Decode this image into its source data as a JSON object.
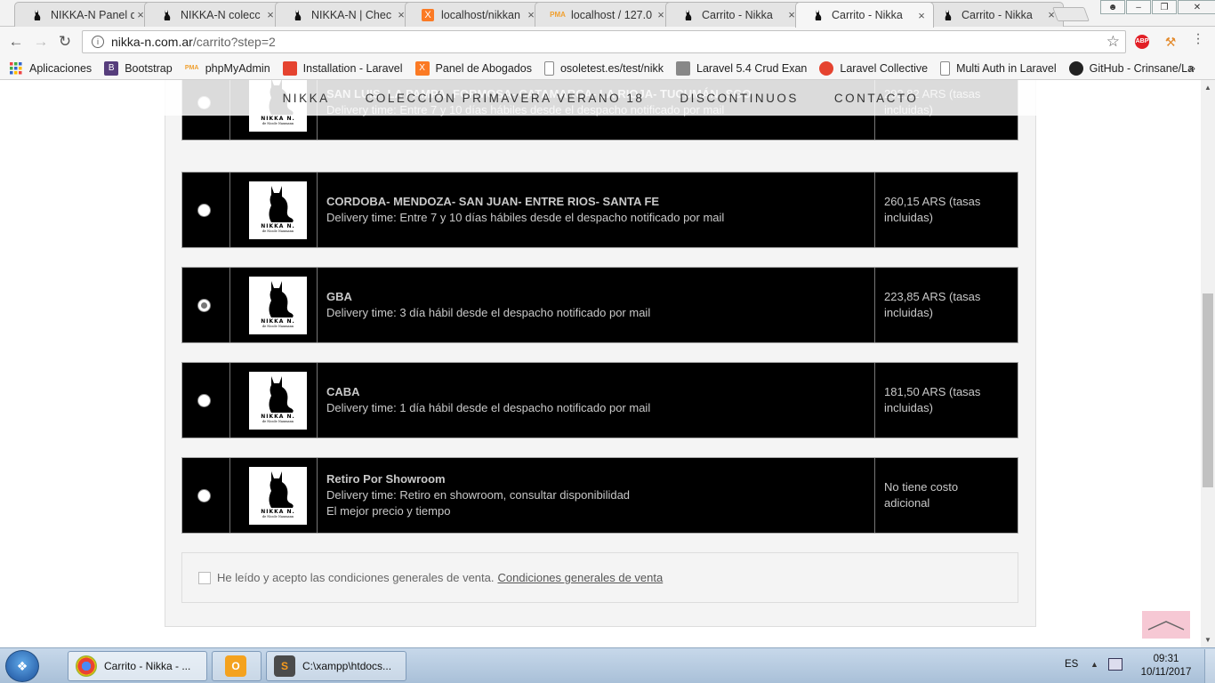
{
  "browser": {
    "tabs": [
      {
        "title": "NIKKA-N Panel d",
        "favicon": "cat-icon",
        "active": false
      },
      {
        "title": "NIKKA-N colecc",
        "favicon": "cat-icon",
        "active": false
      },
      {
        "title": "NIKKA-N | Chec",
        "favicon": "cat-icon",
        "active": false
      },
      {
        "title": "localhost/nikkan",
        "favicon": "xampp-icon",
        "active": false
      },
      {
        "title": "localhost / 127.0",
        "favicon": "phpmyadmin-icon",
        "active": false
      },
      {
        "title": "Carrito - Nikka",
        "favicon": "cat-icon",
        "active": false
      },
      {
        "title": "Carrito - Nikka",
        "favicon": "cat-icon",
        "active": true
      },
      {
        "title": "Carrito - Nikka",
        "favicon": "cat-icon",
        "active": false
      }
    ],
    "close_glyph": "×",
    "url_host": "nikka-n.com.ar",
    "url_path": "/carrito?step=2",
    "extensions": [
      {
        "label": "ABP",
        "color": "#e21f26"
      },
      {
        "label": "",
        "color": "#e38a2b"
      }
    ]
  },
  "bookmarks": [
    {
      "label": "Aplicaciones",
      "icon": "apps-grid-icon",
      "color": "#e44"
    },
    {
      "label": "Bootstrap",
      "icon": "bootstrap-icon",
      "color": "#563d7c"
    },
    {
      "label": "phpMyAdmin",
      "icon": "phpmyadmin-icon",
      "color": "#f0a030"
    },
    {
      "label": "Installation - Laravel",
      "icon": "laravel-icon",
      "color": "#e5432f"
    },
    {
      "label": "Panel de Abogados",
      "icon": "xampp-icon",
      "color": "#fb7a24"
    },
    {
      "label": "osoletest.es/test/nikk",
      "icon": "page-icon",
      "color": "#ffffff"
    },
    {
      "label": "Laravel 5.4 Crud Exan",
      "icon": "appdev-icon",
      "color": "#888888"
    },
    {
      "label": "Laravel Collective",
      "icon": "laravel-collective-icon",
      "color": "#e5432f"
    },
    {
      "label": "Multi Auth in Laravel",
      "icon": "page-icon",
      "color": "#ffffff"
    },
    {
      "label": "GitHub - Crinsane/La",
      "icon": "github-icon",
      "color": "#222222"
    }
  ],
  "bookmarks_more": "»",
  "site_nav": [
    "NIKKA",
    "COLECCIÓN PRIMAVERA VERANO 18",
    "DISCONTINUOS",
    "CONTACTO"
  ],
  "logo": {
    "brand": "NIKKA N.",
    "sub": "de Nicole Naumann"
  },
  "shipping_options": [
    {
      "name": "SAN LUIS- LA PAMPA- FORMOSA- CATAMARCA- LA RIOJA- TUCUMÁN- SGO",
      "delivery": "Delivery time: Entre 7 y 10 días hábiles desde el despacho notificado por mail",
      "extra": "",
      "price_line1": "292,82 ARS (tasas",
      "price_line2": "incluidas)",
      "selected": false
    },
    {
      "name": "CORDOBA- MENDOZA- SAN JUAN- ENTRE RIOS- SANTA FE",
      "delivery": "Delivery time: Entre 7 y 10 días hábiles desde el despacho notificado por mail",
      "extra": "",
      "price_line1": "260,15 ARS (tasas",
      "price_line2": "incluidas)",
      "selected": false
    },
    {
      "name": "GBA",
      "delivery": "Delivery time: 3 día hábil desde el despacho notificado por mail",
      "extra": "",
      "price_line1": "223,85 ARS (tasas",
      "price_line2": "incluidas)",
      "selected": true
    },
    {
      "name": "CABA",
      "delivery": "Delivery time: 1 día hábil desde el despacho notificado por mail",
      "extra": "",
      "price_line1": "181,50 ARS (tasas",
      "price_line2": "incluidas)",
      "selected": false
    },
    {
      "name": "Retiro Por Showroom",
      "delivery": "Delivery time: Retiro en showroom, consultar disponibilidad",
      "extra": "El mejor precio y tiempo",
      "price_line1": "No tiene costo",
      "price_line2": "adicional",
      "selected": false
    }
  ],
  "terms": {
    "text": "He leído y acepto las condiciones generales de venta.",
    "link": "Condiciones generales de venta",
    "checked": false
  },
  "taskbar": {
    "items": [
      {
        "label": "Carrito - Nikka - ...",
        "icon": "chrome-icon",
        "active": true
      },
      {
        "label": "",
        "icon": "outlook-icon",
        "active": false
      },
      {
        "label": "C:\\xampp\\htdocs...",
        "icon": "sublime-text-icon",
        "active": false
      }
    ],
    "language": "ES",
    "time": "09:31",
    "date": "10/11/2017"
  }
}
